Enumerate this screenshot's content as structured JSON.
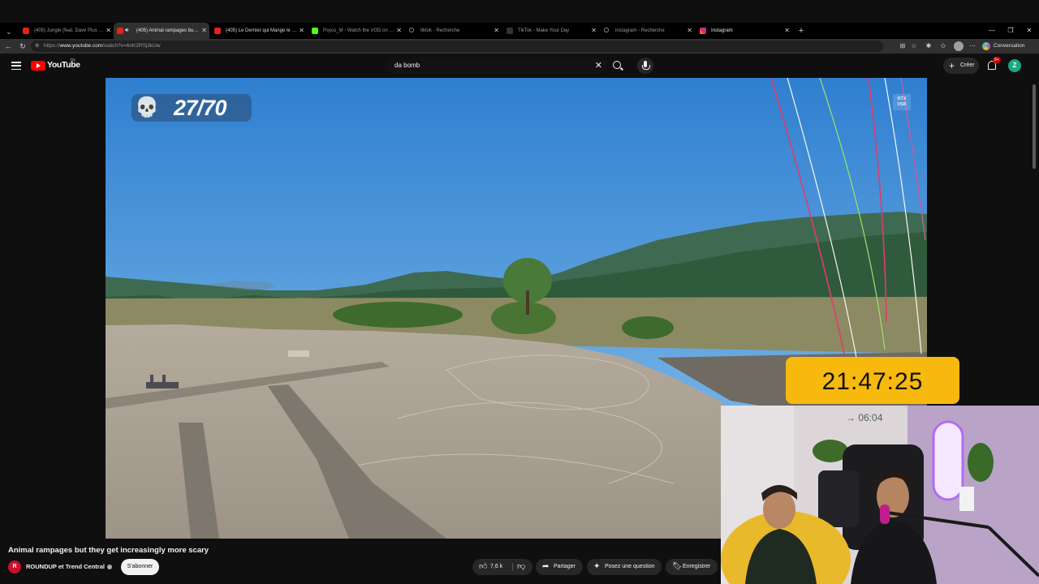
{
  "browser": {
    "tabs": [
      {
        "title": "(405) Jungle (feat. Dave Plus & Sv",
        "favicon": "youtube",
        "active": false
      },
      {
        "title": "(405) Animal rampages but th",
        "favicon": "youtube",
        "active": true,
        "audio": true
      },
      {
        "title": "(405) Le Dernier qui Mange le Pim",
        "favicon": "youtube",
        "active": false
      },
      {
        "title": "Psyco_M - Watch the VOD on Kick",
        "favicon": "kick",
        "active": false
      },
      {
        "title": "tiktok - Recherche",
        "favicon": "search",
        "active": false
      },
      {
        "title": "TikTok - Make Your Day",
        "favicon": "tiktok",
        "active": false
      },
      {
        "title": "instagram - Recherche",
        "favicon": "search",
        "active": false
      },
      {
        "title": "Instagram",
        "favicon": "instagram",
        "active": false
      }
    ],
    "address": {
      "prefix": "https://",
      "host": "www.youtube.com",
      "path": "/watch?v=6nK2RSj3kUw"
    },
    "copilot_label": "Conversation"
  },
  "youtube": {
    "logo_text": "YouTube",
    "logo_region": "TN",
    "search_query": "da bomb",
    "create_label": "Créer",
    "notifications_badge": "9+",
    "avatar_letter": "Z"
  },
  "overlay": {
    "counter_icon": "skull-icon",
    "counter": "27/70",
    "rtx_badge_line1": "RTX",
    "rtx_badge_line2": "VSR",
    "clock": "21:47:25",
    "webcam_timer": "→ 06:04"
  },
  "video": {
    "title": "Animal rampages but they get increasingly more scary",
    "channel_avatar": "R",
    "channel": "ROUNDUP et Trend Central",
    "subscribe_label": "S'abonner",
    "likes": "7,6 k",
    "share_label": "Partager",
    "ask_label": "Posez une question",
    "save_label": "Enregistrer"
  },
  "colors": {
    "youtube_red": "#ff0000",
    "clock_bg": "#f8b90e",
    "background": "#0f0f0f",
    "avatar": "#1ba784"
  }
}
